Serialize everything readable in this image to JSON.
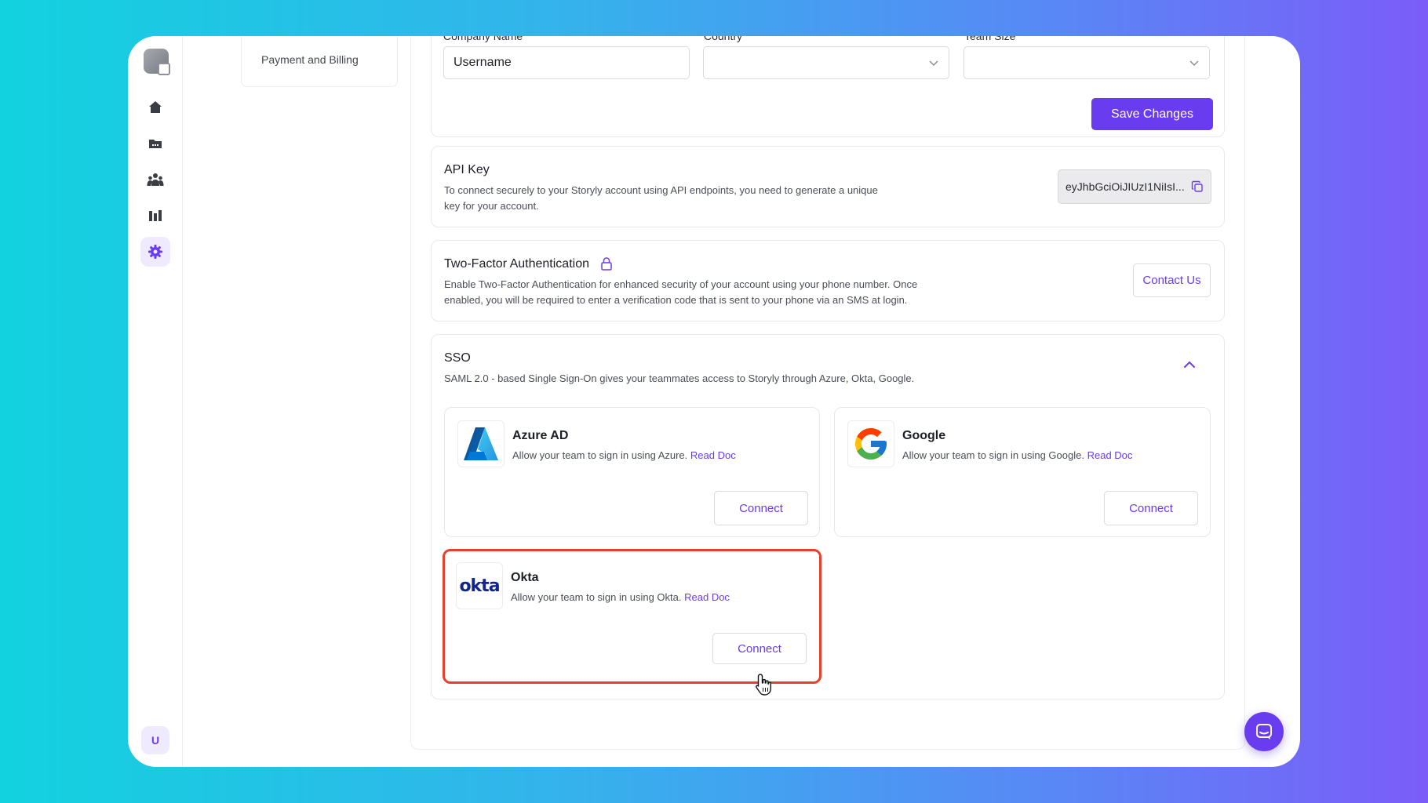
{
  "sidebar": {
    "items": [
      "home",
      "folder",
      "team",
      "analytics",
      "settings"
    ],
    "active": "settings",
    "avatar_initial": "U"
  },
  "subnav": {
    "item": "Payment and Billing"
  },
  "company_form": {
    "company_name_label": "Company Name",
    "company_name_value": "Username",
    "country_label": "Country",
    "country_value": "",
    "team_size_label": "Team Size",
    "team_size_value": "",
    "save_label": "Save Changes"
  },
  "api_key": {
    "title": "API Key",
    "description": "To connect securely to your Storyly account using API endpoints, you need to generate a unique key for your account.",
    "value": "eyJhbGciOiJIUzI1NiIsI..."
  },
  "two_factor": {
    "title": "Two-Factor Authentication",
    "description": "Enable Two-Factor Authentication for enhanced security of your account using your phone number. Once enabled, you will be required to enter a verification code that is sent to your phone via an SMS at login.",
    "button_label": "Contact Us"
  },
  "sso": {
    "title": "SSO",
    "description": "SAML 2.0 - based Single Sign-On gives your teammates access to Storyly through Azure, Okta, Google.",
    "providers": [
      {
        "name": "Azure AD",
        "description": "Allow your team to sign in using Azure.",
        "link": "Read Doc",
        "button": "Connect"
      },
      {
        "name": "Google",
        "description": "Allow your team to sign in using Google.",
        "link": "Read Doc",
        "button": "Connect"
      },
      {
        "name": "Okta",
        "description": "Allow your team to sign in using Okta.",
        "link": "Read Doc",
        "button": "Connect",
        "logo_text": "okta"
      }
    ]
  },
  "colors": {
    "accent": "#6a3cf0",
    "highlight": "#e5412e"
  }
}
